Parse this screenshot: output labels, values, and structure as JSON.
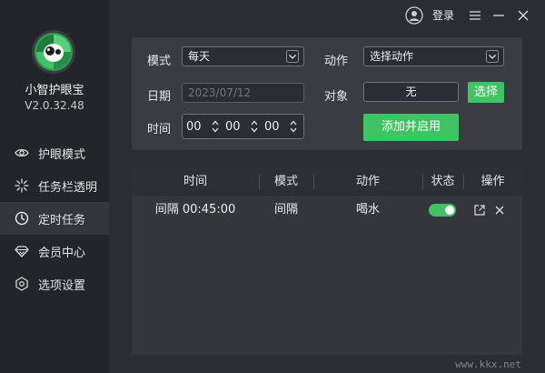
{
  "app": {
    "name": "小智护眼宝",
    "version": "V2.0.32.48"
  },
  "titlebar": {
    "login_label": "登录"
  },
  "sidebar": {
    "items": [
      {
        "label": "护眼模式",
        "icon": "eye-icon",
        "active": false
      },
      {
        "label": "任务栏透明",
        "icon": "sparkle-icon",
        "active": false
      },
      {
        "label": "定时任务",
        "icon": "clock-icon",
        "active": true
      },
      {
        "label": "会员中心",
        "icon": "diamond-icon",
        "active": false
      },
      {
        "label": "选项设置",
        "icon": "settings-icon",
        "active": false
      }
    ]
  },
  "form": {
    "mode_label": "模式",
    "mode_value": "每天",
    "action_label": "动作",
    "action_value": "选择动作",
    "date_label": "日期",
    "date_placeholder": "2023/07/12",
    "target_label": "对象",
    "target_value": "无",
    "select_button": "选择",
    "time_label": "时间",
    "time_hours": "00",
    "time_minutes": "00",
    "time_seconds": "00",
    "add_button": "添加并启用"
  },
  "table": {
    "headers": [
      "时间",
      "模式",
      "动作",
      "状态",
      "操作"
    ],
    "rows": [
      {
        "time": "间隔 00:45:00",
        "mode": "间隔",
        "action": "喝水",
        "enabled": true
      }
    ]
  },
  "watermark": "www.kkx.net",
  "colors": {
    "accent": "#3ec463",
    "sidebar_bg": "#23252a",
    "panel_bg": "#3a3c42"
  }
}
